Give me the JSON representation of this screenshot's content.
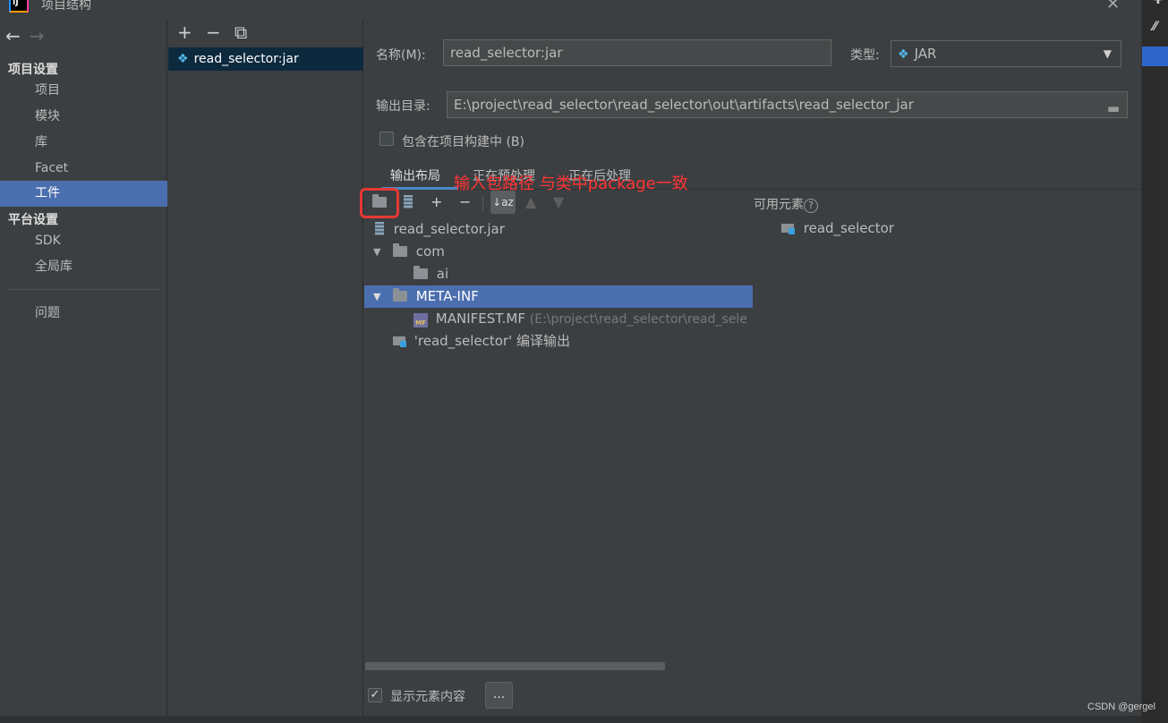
{
  "window": {
    "title": "项目结构",
    "logo_text": "IJ",
    "close_glyph": "✕"
  },
  "nav": {
    "back_glyph": "←",
    "forward_glyph": "→",
    "section_project": "项目设置",
    "section_platform": "平台设置",
    "items": [
      "项目",
      "模块",
      "库",
      "Facet",
      "工件"
    ],
    "platform_items": [
      "SDK",
      "全局库"
    ],
    "problems": "问题",
    "selected": "工件"
  },
  "artifacts": {
    "toolbar": [
      "+",
      "−",
      "⧉"
    ],
    "items": [
      "read_selector:jar"
    ]
  },
  "form": {
    "name_label": "名称(M):",
    "name_value": "read_selector:jar",
    "type_label": "类型:",
    "type_value": "JAR",
    "output_label": "输出目录:",
    "output_value": "E:\\project\\read_selector\\read_selector\\out\\artifacts\\read_selector_jar",
    "include_label": "包含在项目构建中 (B)",
    "include_checked": false
  },
  "tabs": [
    "输出布局",
    "正在预处理",
    "正在后处理"
  ],
  "active_tab": "输出布局",
  "annotation": "输入包路径 与类中package一致",
  "layout_tree": [
    {
      "label": "read_selector.jar",
      "icon": "jar-icon",
      "depth": 0
    },
    {
      "label": "com",
      "icon": "folder-icon",
      "depth": 0,
      "expanded": true
    },
    {
      "label": "ai",
      "icon": "folder-icon",
      "depth": 1
    },
    {
      "label": "META-INF",
      "icon": "folder-icon",
      "depth": 0,
      "expanded": true,
      "selected": true
    },
    {
      "label": "MANIFEST.MF",
      "extra": "(E:\\project\\read_selector\\read_sele",
      "icon": "manifest-icon",
      "depth": 1
    },
    {
      "label": "'read_selector' 编译输出",
      "icon": "module-output-icon",
      "depth": 0
    }
  ],
  "available": {
    "title": "可用元素",
    "help_glyph": "?",
    "items": [
      "read_selector"
    ]
  },
  "footer": {
    "show_content_label": "显示元素内容",
    "show_content_checked": true,
    "dots_label": "...",
    "check_glyph": "✓"
  },
  "watermark": "CSDN @gergel"
}
